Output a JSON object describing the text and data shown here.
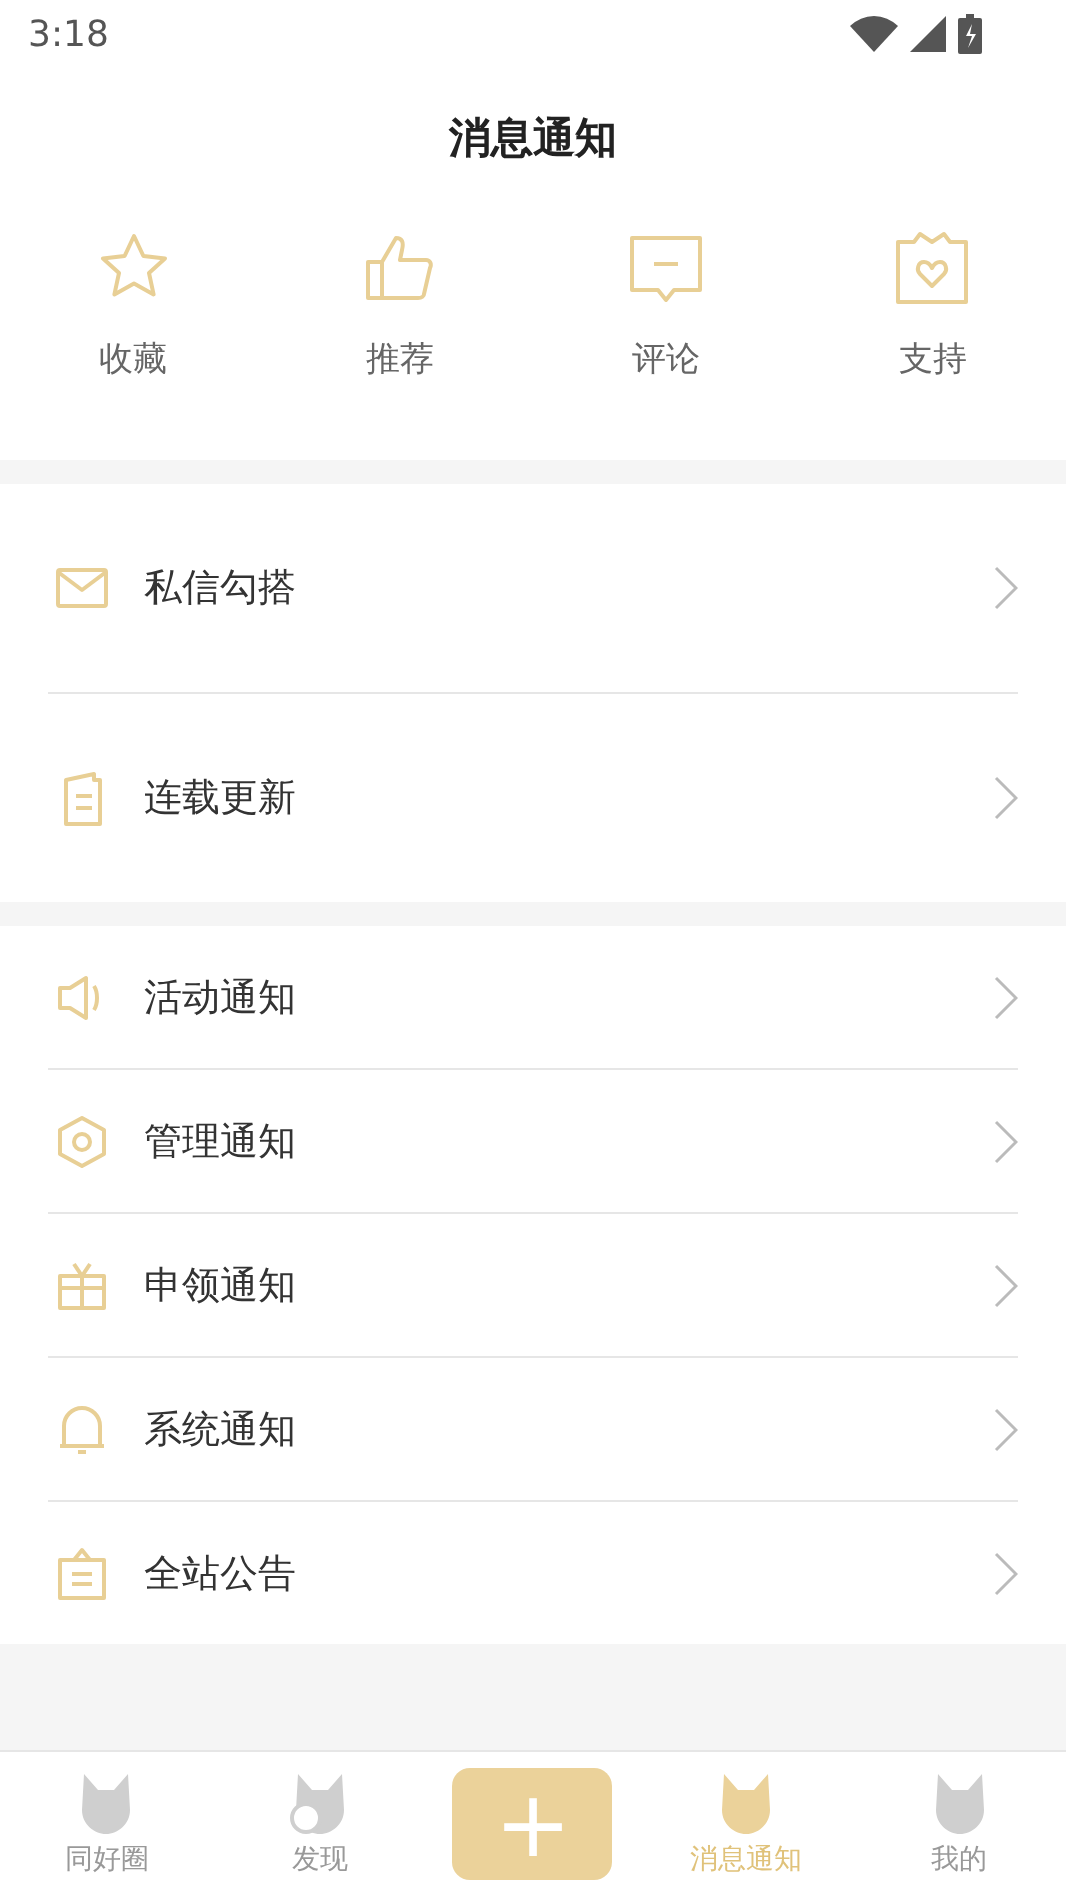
{
  "status_bar": {
    "time": "3:18"
  },
  "header": {
    "title": "消息通知"
  },
  "quick_actions": [
    {
      "label": "收藏"
    },
    {
      "label": "推荐"
    },
    {
      "label": "评论"
    },
    {
      "label": "支持"
    }
  ],
  "groups": [
    {
      "rows": [
        {
          "label": "私信勾搭"
        },
        {
          "label": "连载更新"
        }
      ],
      "tall": true
    },
    {
      "rows": [
        {
          "label": "活动通知"
        },
        {
          "label": "管理通知"
        },
        {
          "label": "申领通知"
        },
        {
          "label": "系统通知"
        },
        {
          "label": "全站公告"
        }
      ],
      "tall": false
    }
  ],
  "bottom_nav": [
    {
      "kind": "tab",
      "label": "同好圈",
      "selected": false
    },
    {
      "kind": "tab",
      "label": "发现",
      "selected": false
    },
    {
      "kind": "add",
      "label": "+"
    },
    {
      "kind": "tab",
      "label": "消息通知",
      "selected": true
    },
    {
      "kind": "tab",
      "label": "我的",
      "selected": false
    }
  ]
}
